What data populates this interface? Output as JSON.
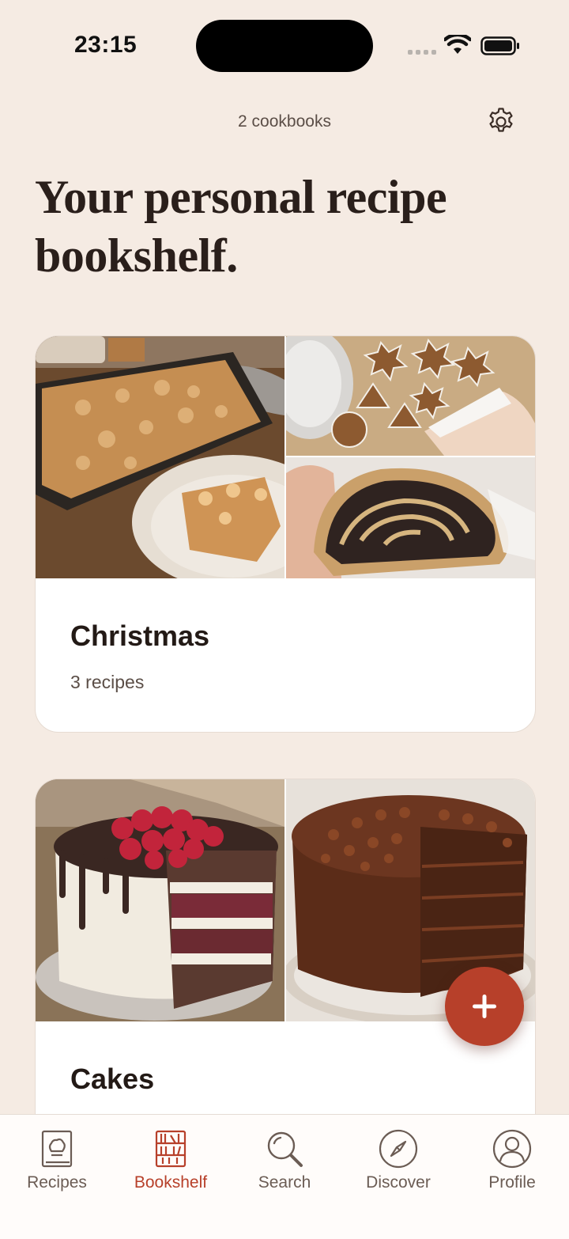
{
  "status": {
    "time": "23:15"
  },
  "header": {
    "cookbook_count": "2 cookbooks",
    "headline": "Your personal recipe bookshelf."
  },
  "cookbooks": [
    {
      "title": "Christmas",
      "subtitle": "3 recipes"
    },
    {
      "title": "Cakes",
      "subtitle": ""
    }
  ],
  "tabs": [
    {
      "label": "Recipes",
      "icon": "cookbook-icon",
      "active": false
    },
    {
      "label": "Bookshelf",
      "icon": "bookshelf-icon",
      "active": true
    },
    {
      "label": "Search",
      "icon": "search-icon",
      "active": false
    },
    {
      "label": "Discover",
      "icon": "compass-icon",
      "active": false
    },
    {
      "label": "Profile",
      "icon": "profile-icon",
      "active": false
    }
  ],
  "colors": {
    "background": "#f5ebe3",
    "accent": "#b7402a",
    "text": "#2a1f1b"
  }
}
